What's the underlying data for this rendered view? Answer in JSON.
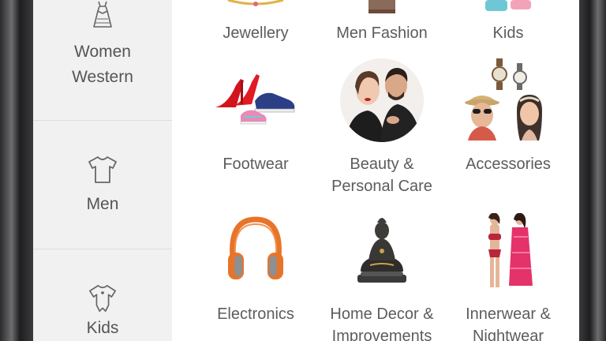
{
  "sidebar": {
    "items": [
      {
        "label": "Women\nWestern",
        "icon": "dress-icon"
      },
      {
        "label": "Men",
        "icon": "tshirt-icon"
      },
      {
        "label": "Kids",
        "icon": "onesie-icon"
      }
    ]
  },
  "categories": [
    {
      "label": "Jewellery"
    },
    {
      "label": "Men Fashion"
    },
    {
      "label": "Kids"
    },
    {
      "label": "Footwear"
    },
    {
      "label": "Beauty &\nPersonal Care"
    },
    {
      "label": "Accessories"
    },
    {
      "label": "Electronics"
    },
    {
      "label": "Home Decor &\nImprovements"
    },
    {
      "label": "Innerwear &\nNightwear"
    }
  ],
  "colors": {
    "sidebar_bg": "#f1f1f1",
    "text": "#5c5c5c",
    "headphone_orange": "#e8742a"
  }
}
